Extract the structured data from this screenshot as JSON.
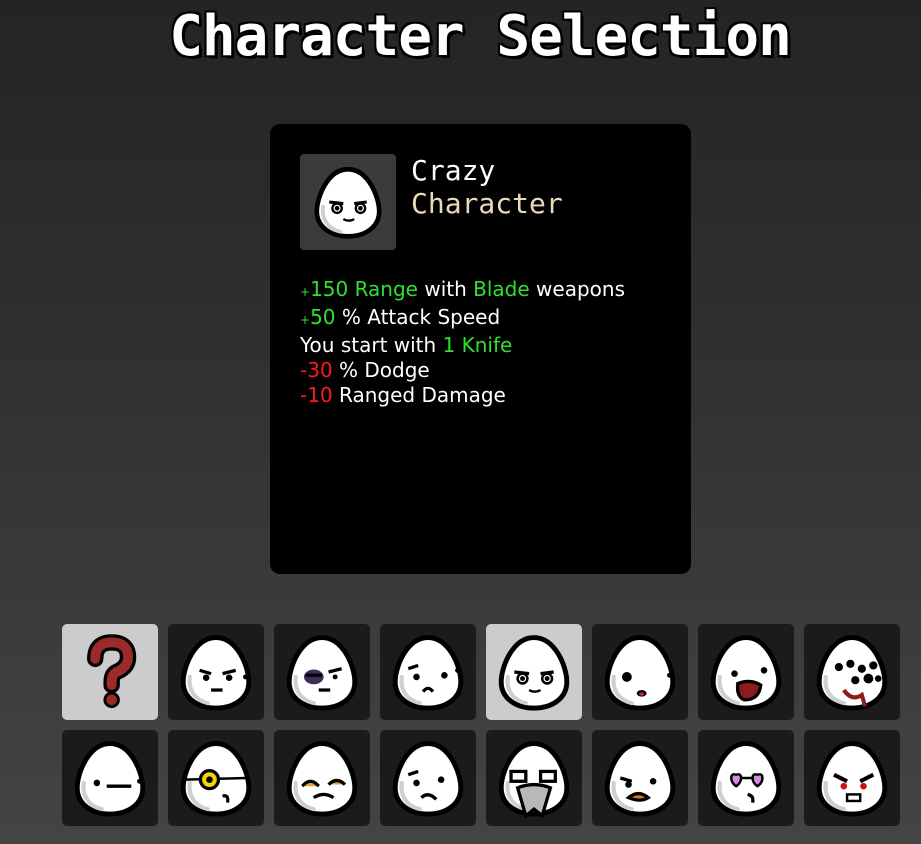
{
  "title": "Character Selection",
  "selected": {
    "name": "Crazy",
    "type": "Character",
    "stats": [
      {
        "parts": [
          {
            "t": "+",
            "c": "green",
            "s": true
          },
          {
            "t": "150 Range",
            "c": "green"
          },
          {
            "t": " with "
          },
          {
            "t": "Blade",
            "c": "green"
          },
          {
            "t": " weapons"
          }
        ]
      },
      {
        "parts": [
          {
            "t": "+",
            "c": "green",
            "s": true
          },
          {
            "t": "50",
            "c": "green"
          },
          {
            "t": " % Attack Speed"
          }
        ]
      },
      {
        "parts": [
          {
            "t": "You start with "
          },
          {
            "t": "1 Knife",
            "c": "green"
          }
        ]
      },
      {
        "parts": [
          {
            "t": "-",
            "c": "red"
          },
          {
            "t": "30",
            "c": "red"
          },
          {
            "t": " % Dodge"
          }
        ]
      },
      {
        "parts": [
          {
            "t": "-",
            "c": "red"
          },
          {
            "t": "10",
            "c": "red"
          },
          {
            "t": " Ranged Damage"
          }
        ]
      }
    ]
  },
  "colors": {
    "positive": "#2fe02f",
    "negative": "#ff1a1a",
    "type_label": "#eadbb6",
    "selected_cell": "#cccccc"
  },
  "characters": [
    {
      "icon": "random-question-mark-icon",
      "face": "random",
      "selected": false,
      "highlight": true
    },
    {
      "icon": "grumpy-egg-icon",
      "face": "grumpy"
    },
    {
      "icon": "bruised-egg-icon",
      "face": "bruised"
    },
    {
      "icon": "pouting-egg-icon",
      "face": "pout"
    },
    {
      "icon": "crazy-egg-icon",
      "face": "crazy",
      "selected": true,
      "highlight": true
    },
    {
      "icon": "surprised-egg-icon",
      "face": "surprised"
    },
    {
      "icon": "shouting-egg-icon",
      "face": "shout"
    },
    {
      "icon": "many-eyes-egg-icon",
      "face": "manyeyes"
    },
    {
      "icon": "neutral-egg-icon",
      "face": "neutral"
    },
    {
      "icon": "monocle-egg-icon",
      "face": "monocle"
    },
    {
      "icon": "mustache-egg-icon",
      "face": "mustache"
    },
    {
      "icon": "worried-egg-icon",
      "face": "worried"
    },
    {
      "icon": "bearded-egg-icon",
      "face": "beard"
    },
    {
      "icon": "orange-mustache-egg-icon",
      "face": "orangestache"
    },
    {
      "icon": "heart-glasses-egg-icon",
      "face": "hearts"
    },
    {
      "icon": "angry-egg-icon",
      "face": "angry"
    }
  ]
}
